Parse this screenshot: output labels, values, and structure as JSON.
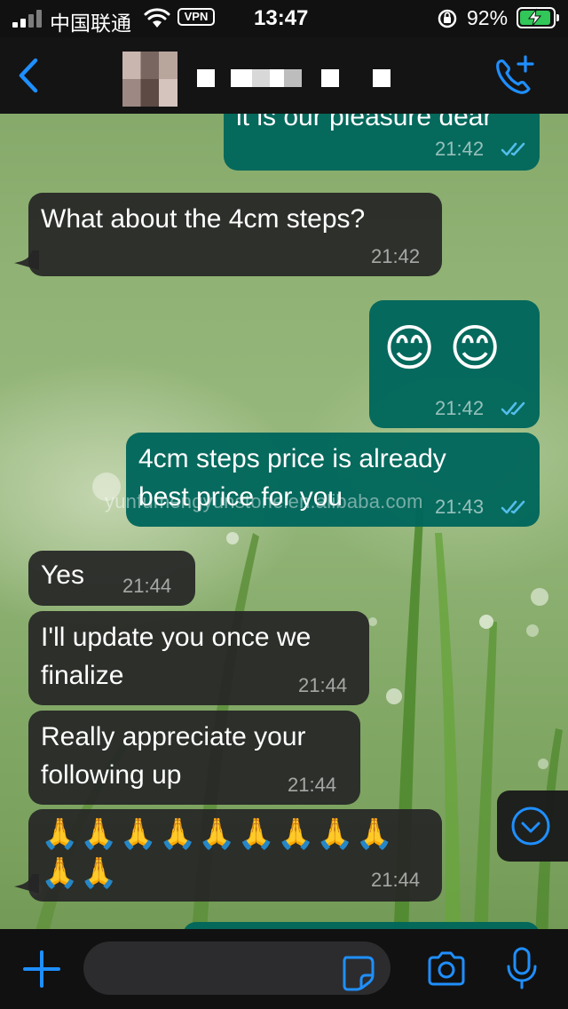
{
  "status_bar": {
    "carrier": "中国联通",
    "vpn": "VPN",
    "time": "13:47",
    "battery_percent": "92%",
    "signal_icon": "signal-bars-icon",
    "wifi_icon": "wifi-icon",
    "rotation_lock_icon": "rotation-lock-icon",
    "battery_icon": "battery-charging-icon"
  },
  "header": {
    "back_icon": "chevron-left-icon",
    "call_icon": "phone-plus-icon",
    "contact_name_redacted": true
  },
  "messages": [
    {
      "direction": "out",
      "text": "it is our pleasure dear",
      "time": "21:42",
      "read": true
    },
    {
      "direction": "in",
      "text": "What about the 4cm steps?",
      "time": "21:42"
    },
    {
      "direction": "out",
      "text": "😊 😊",
      "time": "21:42",
      "read": true
    },
    {
      "direction": "out",
      "text": "4cm steps price is already\nbest price for you",
      "time": "21:43",
      "read": true
    },
    {
      "direction": "in",
      "text": "Yes",
      "time": "21:44"
    },
    {
      "direction": "in",
      "text": "I'll update you once we\nfinalize",
      "time": "21:44"
    },
    {
      "direction": "in",
      "text": "Really appreciate your\nfollowing up",
      "time": "21:44"
    },
    {
      "direction": "in",
      "text": "🙏🙏🙏🙏🙏🙏🙏🙏🙏\n🙏🙏",
      "time": "21:44"
    }
  ],
  "watermark": "yunfumengyunstonelen.alibaba.com",
  "input_bar": {
    "placeholder": "",
    "attach_icon": "plus-icon",
    "sticker_icon": "sticker-icon",
    "camera_icon": "camera-icon",
    "mic_icon": "microphone-icon",
    "scroll_icon": "chevron-down-circle-icon"
  },
  "colors": {
    "accent": "#1f8fff",
    "outgoing_bubble": "#00665c",
    "incoming_bubble": "#262626",
    "read_ticks": "#53bdeb"
  }
}
